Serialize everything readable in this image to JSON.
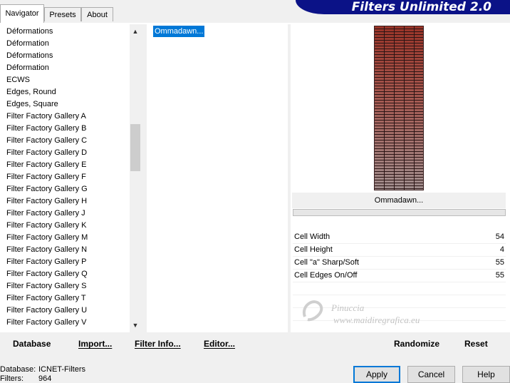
{
  "tabs": [
    "Navigator",
    "Presets",
    "About"
  ],
  "app_title": "Filters Unlimited 2.0",
  "categories": [
    "Déformations",
    "Déformation",
    "Déformations",
    "Déformation",
    "ECWS",
    "Edges, Round",
    "Edges, Square",
    "Filter Factory Gallery A",
    "Filter Factory Gallery B",
    "Filter Factory Gallery C",
    "Filter Factory Gallery D",
    "Filter Factory Gallery E",
    "Filter Factory Gallery F",
    "Filter Factory Gallery G",
    "Filter Factory Gallery H",
    "Filter Factory Gallery J",
    "Filter Factory Gallery K",
    "Filter Factory Gallery M",
    "Filter Factory Gallery N",
    "Filter Factory Gallery P",
    "Filter Factory Gallery Q",
    "Filter Factory Gallery S",
    "Filter Factory Gallery T",
    "Filter Factory Gallery U",
    "Filter Factory Gallery V"
  ],
  "filters": [
    "Ommadawn..."
  ],
  "preview": {
    "filter_name": "Ommadawn..."
  },
  "params": [
    {
      "label": "Cell Width",
      "value": "54"
    },
    {
      "label": "Cell Height",
      "value": "4"
    },
    {
      "label": "Cell \"a\" Sharp/Soft",
      "value": "55"
    },
    {
      "label": "Cell Edges On/Off",
      "value": "55"
    }
  ],
  "watermark": {
    "name": "Pinuccia",
    "site": "www.maidiregrafica.eu"
  },
  "toolbar": {
    "database": "Database",
    "import": "Import...",
    "filter_info": "Filter Info...",
    "editor": "Editor...",
    "randomize": "Randomize",
    "reset": "Reset"
  },
  "status": {
    "database_label": "Database:",
    "database_value": "ICNET-Filters",
    "filters_label": "Filters:",
    "filters_value": "964"
  },
  "buttons": {
    "apply": "Apply",
    "cancel": "Cancel",
    "help": "Help"
  },
  "colors": {
    "selection": "#0078d7",
    "title_bg": "#0b1287"
  }
}
